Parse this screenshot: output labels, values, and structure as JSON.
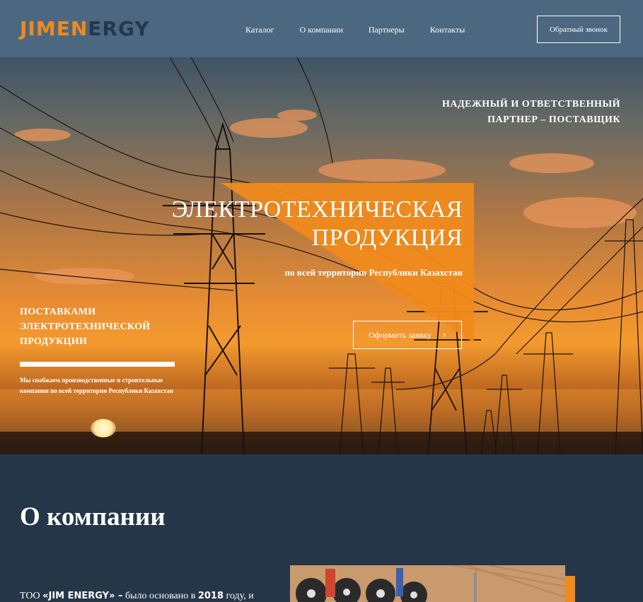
{
  "header": {
    "logo": {
      "part1": "JIM",
      "part2": "E",
      "part3": "N",
      "part4": "ERGY"
    },
    "nav": [
      "Каталог",
      "О компании",
      "Партнеры",
      "Контакты"
    ],
    "callback_label": "Обратный звонок"
  },
  "hero": {
    "tagline_line1": "НАДЕЖНЫЙ И ОТВЕТСТВЕННЫЙ",
    "tagline_line2": "ПАРТНЕР – ПОСТАВЩИК",
    "title_line1": "ЭЛЕКТРОТЕХНИЧЕСКАЯ",
    "title_line2": "ПРОДУКЦИЯ",
    "subtitle": "по всей территории Республики Казахстан",
    "order_label": "Оформить заявку",
    "left_title_line1": "ПОСТАВКАМИ",
    "left_title_line2": "ЭЛЕКТРОТЕХНИЧЕСКОЙ",
    "left_title_line3": "ПРОДУКЦИИ",
    "left_desc": "Мы снабжаем производственные и строительные компании по всей территории Республики Казахстан"
  },
  "about": {
    "title": "О компании",
    "text_prefix": "ТОО ",
    "text_company": "«JIM ENERGY» –",
    "text_middle": " было основано в ",
    "text_year": "2018",
    "text_suffix": " году, и"
  },
  "colors": {
    "accent": "#f08a1c",
    "header_bg": "#4c6880",
    "page_bg": "#253648"
  }
}
